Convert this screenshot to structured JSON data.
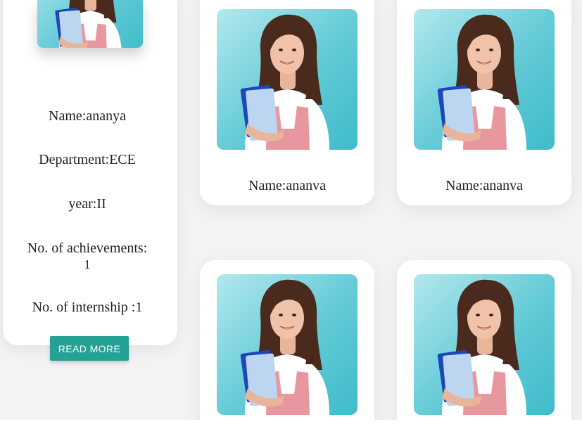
{
  "detail_card": {
    "image_alt": "student photo",
    "name": "Name:ananya",
    "department": "Department:ECE",
    "year": "year:II",
    "achievements_label": "No. of achievements:",
    "achievements_value": "1",
    "internships": "No. of internship :1",
    "read_more_label": "READ MORE"
  },
  "cards": [
    {
      "name": "Name:ananva",
      "image_alt": "student photo"
    },
    {
      "name": "Name:ananva",
      "image_alt": "student photo"
    },
    {
      "name": "",
      "image_alt": "student photo"
    },
    {
      "name": "",
      "image_alt": "student photo"
    }
  ],
  "colors": {
    "button": "#26a196",
    "photo_background": "#6fd0dc",
    "page_background": "#f3f3f3"
  }
}
